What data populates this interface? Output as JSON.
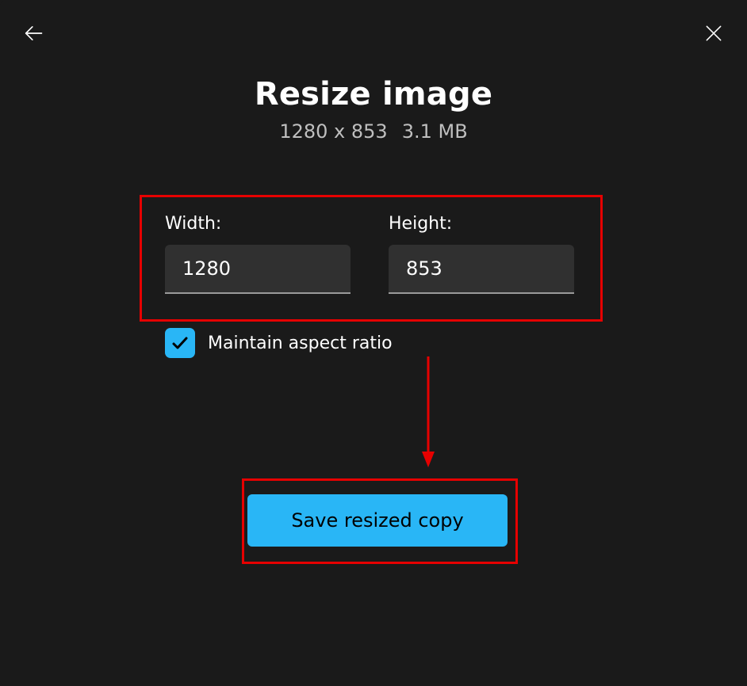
{
  "title": "Resize image",
  "subtitle": {
    "dims": "1280 x 853",
    "size": "3.1 MB"
  },
  "fields": {
    "width": {
      "label": "Width:",
      "value": "1280"
    },
    "height": {
      "label": "Height:",
      "value": "853"
    }
  },
  "aspect": {
    "checked": true,
    "label": "Maintain aspect ratio"
  },
  "save_label": "Save resized copy"
}
